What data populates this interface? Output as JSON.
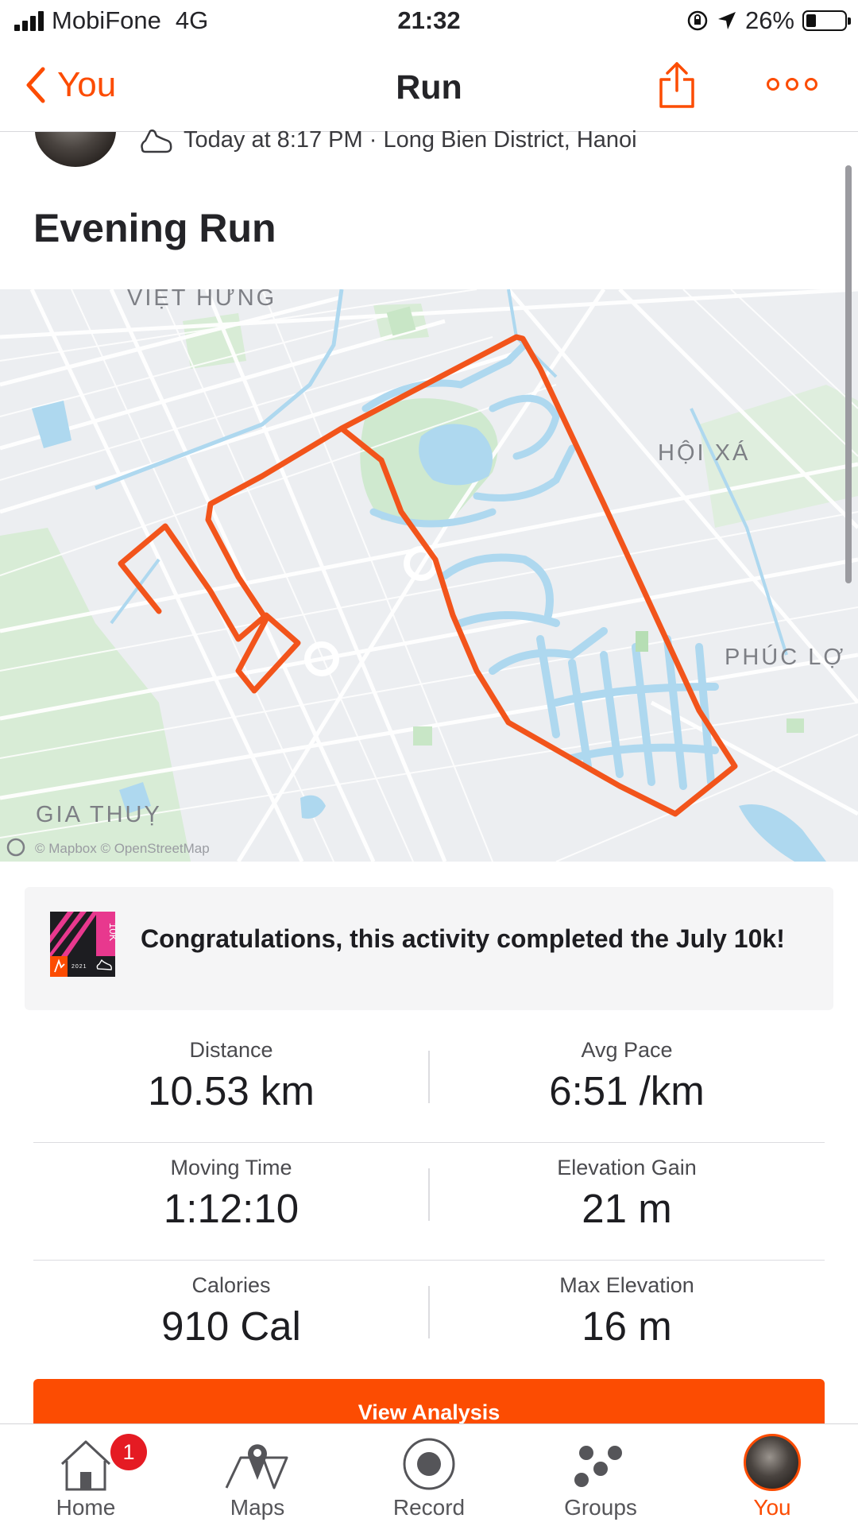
{
  "status_bar": {
    "carrier": "MobiFone",
    "network": "4G",
    "time": "21:32",
    "battery": "26%"
  },
  "nav": {
    "back_label": "You",
    "title": "Run"
  },
  "activity": {
    "meta": "Today at 8:17 PM · Long Bien District, Hanoi",
    "title": "Evening Run"
  },
  "map": {
    "labels": {
      "viet_hung": "VIỆT HƯNG",
      "hoi_xa": "HỘI XÁ",
      "phuc_loi": "PHÚC LỢ",
      "gia_thuy": "GIA THUỴ"
    },
    "attribution": "© Mapbox © OpenStreetMap",
    "route_color": "#f2541b",
    "water_color": "#aed8ef",
    "park_color": "#cfe9cf"
  },
  "challenge": {
    "text": "Congratulations, this activity completed the July 10k!",
    "badge_text": "10K",
    "badge_year": "2021",
    "badge_colors": {
      "magenta": "#e8388e",
      "orange": "#fc4c02",
      "dark": "#1d1d21"
    }
  },
  "stats": [
    {
      "left": {
        "label": "Distance",
        "value": "10.53 km"
      },
      "right": {
        "label": "Avg Pace",
        "value": "6:51 /km"
      }
    },
    {
      "left": {
        "label": "Moving Time",
        "value": "1:12:10"
      },
      "right": {
        "label": "Elevation Gain",
        "value": "21 m"
      }
    },
    {
      "left": {
        "label": "Calories",
        "value": "910 Cal"
      },
      "right": {
        "label": "Max Elevation",
        "value": "16 m"
      }
    }
  ],
  "analysis_button": "View Analysis",
  "tabbar": {
    "items": [
      {
        "label": "Home",
        "icon": "home-icon",
        "badge": "1"
      },
      {
        "label": "Maps",
        "icon": "map-pin-icon"
      },
      {
        "label": "Record",
        "icon": "record-icon"
      },
      {
        "label": "Groups",
        "icon": "groups-icon"
      },
      {
        "label": "You",
        "icon": "avatar"
      }
    ]
  },
  "colors": {
    "accent": "#fc4c02",
    "text": "#242428",
    "muted": "#4a4a4e"
  }
}
